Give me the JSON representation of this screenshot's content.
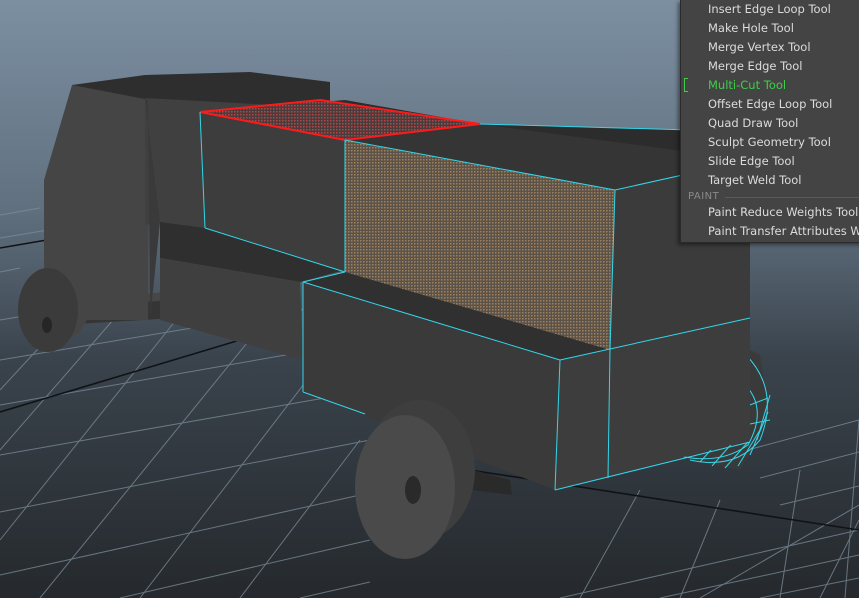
{
  "viewport": {
    "background_top": "#7c8fa1",
    "background_bottom": "#25292d",
    "grid_color": "#7d8e9b",
    "selection_edge_color": "#ff1a1a",
    "wire_color": "#33d6ea",
    "highlight_face_color": "#a0805a"
  },
  "menu": {
    "items": [
      {
        "label": "Insert Edge Loop Tool",
        "active": false
      },
      {
        "label": "Make Hole Tool",
        "active": false
      },
      {
        "label": "Merge Vertex Tool",
        "active": false
      },
      {
        "label": "Merge Edge Tool",
        "active": false
      },
      {
        "label": "Multi-Cut Tool",
        "active": true
      },
      {
        "label": "Offset Edge Loop Tool",
        "active": false
      },
      {
        "label": "Quad Draw Tool",
        "active": false
      },
      {
        "label": "Sculpt Geometry Tool",
        "active": false
      },
      {
        "label": "Slide Edge Tool",
        "active": false
      },
      {
        "label": "Target Weld Tool",
        "active": false
      }
    ],
    "section_paint": "PAINT",
    "paint_items": [
      {
        "label": "Paint Reduce Weights Tool"
      },
      {
        "label": "Paint Transfer Attributes Wei"
      }
    ],
    "active_color": "#3fce4a"
  }
}
